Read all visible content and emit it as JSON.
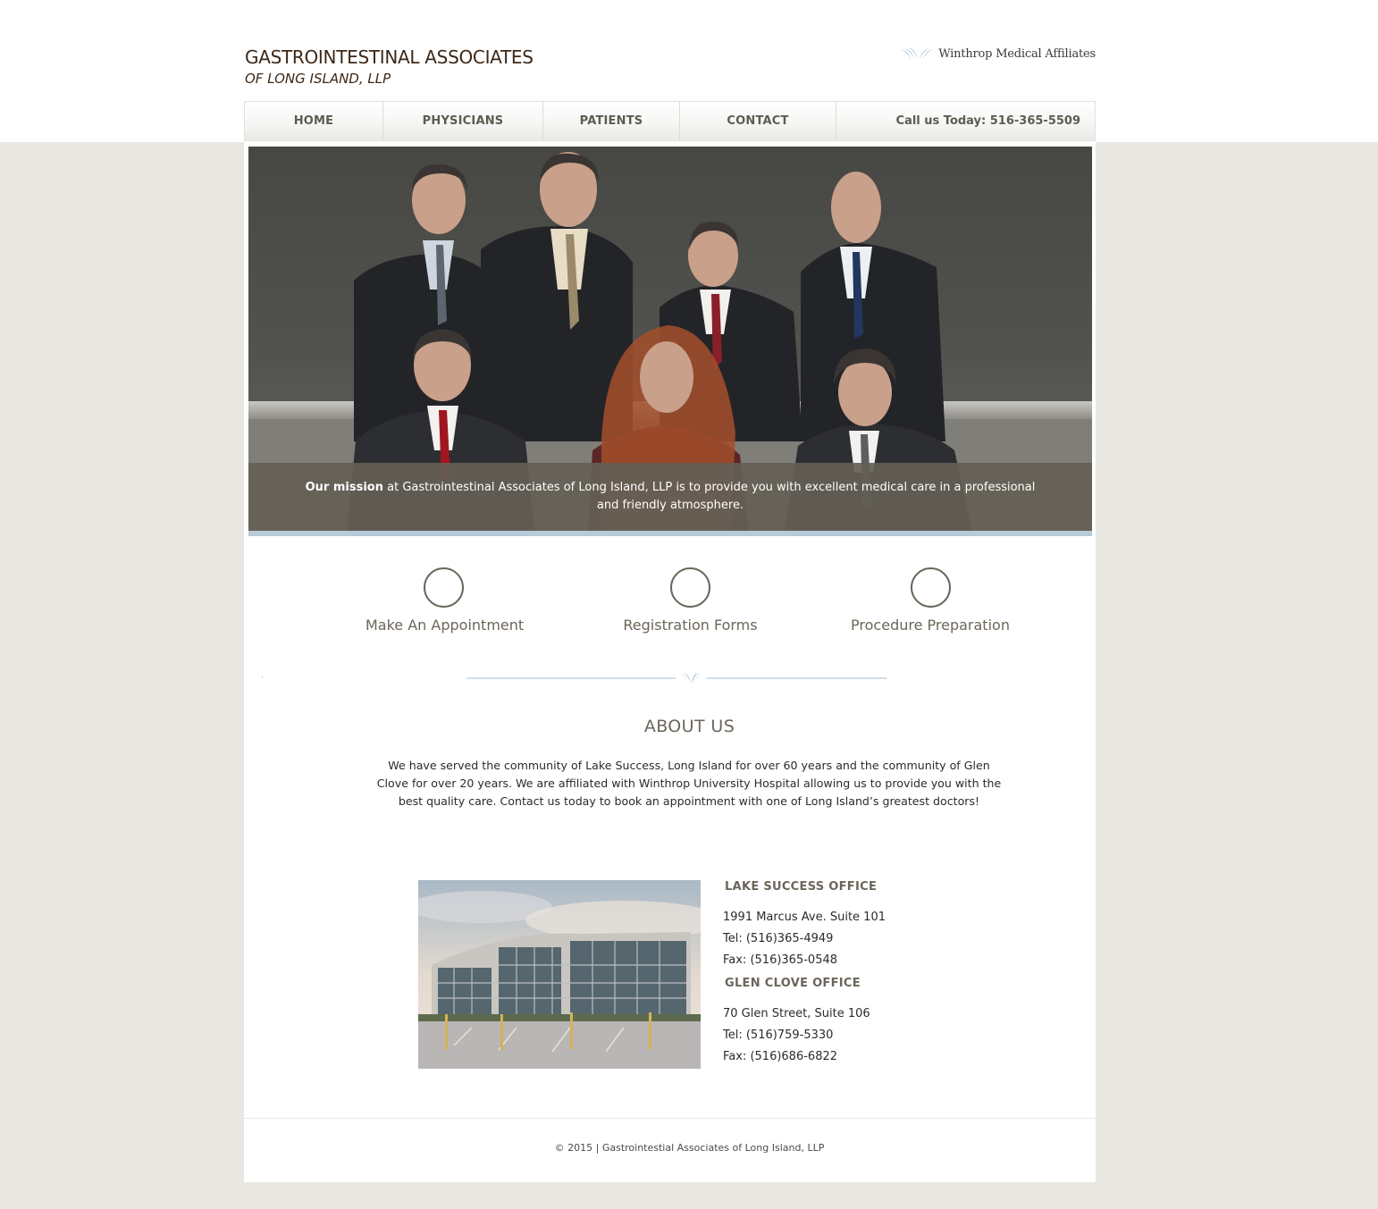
{
  "header": {
    "logo_line1": "GASTROINTESTINAL ASSOCIATES",
    "logo_line2": "OF LONG ISLAND, LLP",
    "affiliate_text": "Winthrop Medical Affiliates"
  },
  "nav": {
    "items": [
      {
        "label": "HOME"
      },
      {
        "label": "PHYSICIANS"
      },
      {
        "label": "PATIENTS"
      },
      {
        "label": "CONTACT"
      }
    ],
    "phone": "Call us Today: 516-365-5509"
  },
  "hero": {
    "mission_bold": "Our mission",
    "mission_text": " at Gastrointestinal Associates of Long Island, LLP is to provide you with excellent medical care in a professional and friendly atmosphere."
  },
  "quick_links": [
    {
      "label": "Make An Appointment"
    },
    {
      "label": "Registration Forms"
    },
    {
      "label": "Procedure Preparation"
    }
  ],
  "about": {
    "title": "ABOUT US",
    "text": "We have served the community of Lake Success, Long Island for over 60 years and the community of Glen Clove for over 20 years. We are affiliated with Winthrop University Hospital allowing us to provide you with the best quality care. Contact us today to book an appointment with one of Long Island’s greatest doctors!"
  },
  "offices": [
    {
      "title": "LAKE SUCCESS OFFICE",
      "address": "1991 Marcus Ave. Suite 101",
      "tel": "Tel: (516)365-4949",
      "fax": "Fax: (516)365-0548"
    },
    {
      "title": "GLEN CLOVE OFFICE",
      "address": "70 Glen Street, Suite 106",
      "tel": "Tel: (516)759-5330",
      "fax": "Fax: (516)686-6822"
    }
  ],
  "footer": {
    "text": "© 2015 | Gastrointestial Associates of Long Island, LLP"
  },
  "colors": {
    "background": "#e8e7e1",
    "text_brown": "#3d2817",
    "accent_taupe": "#6b665a",
    "mission_band": "#645f56",
    "stripe_blue": "#b7cad8"
  }
}
